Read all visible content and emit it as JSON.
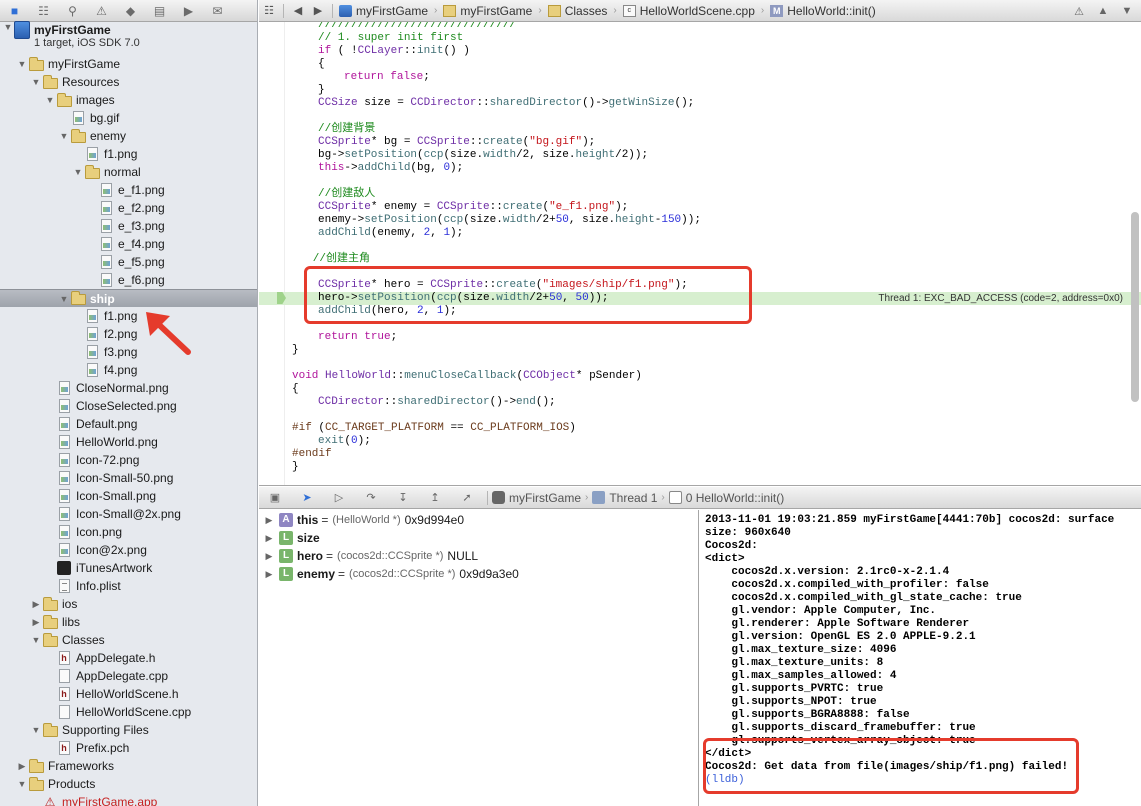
{
  "navigator": {
    "toolbar": [
      "folder-icon",
      "symbol-icon",
      "search-icon",
      "warning-icon",
      "test-icon",
      "debug-icon",
      "breakpoint-icon",
      "log-icon"
    ],
    "project": {
      "name": "myFirstGame",
      "subtitle": "1 target, iOS SDK 7.0"
    },
    "tree": [
      {
        "label": "myFirstGame",
        "kind": "folder",
        "depth": 1,
        "open": true
      },
      {
        "label": "Resources",
        "kind": "folder",
        "depth": 2,
        "open": true
      },
      {
        "label": "images",
        "kind": "folder",
        "depth": 3,
        "open": true
      },
      {
        "label": "bg.gif",
        "kind": "image",
        "depth": 4
      },
      {
        "label": "enemy",
        "kind": "folder",
        "depth": 4,
        "open": true
      },
      {
        "label": "f1.png",
        "kind": "image",
        "depth": 5
      },
      {
        "label": "normal",
        "kind": "folder",
        "depth": 5,
        "open": true
      },
      {
        "label": "e_f1.png",
        "kind": "image",
        "depth": 6
      },
      {
        "label": "e_f2.png",
        "kind": "image",
        "depth": 6
      },
      {
        "label": "e_f3.png",
        "kind": "image",
        "depth": 6
      },
      {
        "label": "e_f4.png",
        "kind": "image",
        "depth": 6
      },
      {
        "label": "e_f5.png",
        "kind": "image",
        "depth": 6
      },
      {
        "label": "e_f6.png",
        "kind": "image",
        "depth": 6
      },
      {
        "label": "ship",
        "kind": "folder",
        "depth": 4,
        "open": true,
        "selected": true
      },
      {
        "label": "f1.png",
        "kind": "image",
        "depth": 5
      },
      {
        "label": "f2.png",
        "kind": "image",
        "depth": 5
      },
      {
        "label": "f3.png",
        "kind": "image",
        "depth": 5
      },
      {
        "label": "f4.png",
        "kind": "image",
        "depth": 5
      },
      {
        "label": "CloseNormal.png",
        "kind": "image",
        "depth": 3
      },
      {
        "label": "CloseSelected.png",
        "kind": "image",
        "depth": 3
      },
      {
        "label": "Default.png",
        "kind": "image",
        "depth": 3
      },
      {
        "label": "HelloWorld.png",
        "kind": "image",
        "depth": 3
      },
      {
        "label": "Icon-72.png",
        "kind": "image",
        "depth": 3
      },
      {
        "label": "Icon-Small-50.png",
        "kind": "image",
        "depth": 3
      },
      {
        "label": "Icon-Small.png",
        "kind": "image",
        "depth": 3
      },
      {
        "label": "Icon-Small@2x.png",
        "kind": "image",
        "depth": 3
      },
      {
        "label": "Icon.png",
        "kind": "image",
        "depth": 3
      },
      {
        "label": "Icon@2x.png",
        "kind": "image",
        "depth": 3
      },
      {
        "label": "iTunesArtwork",
        "kind": "itunes",
        "depth": 3
      },
      {
        "label": "Info.plist",
        "kind": "plist",
        "depth": 3
      },
      {
        "label": "ios",
        "kind": "folder",
        "depth": 2,
        "open": false
      },
      {
        "label": "libs",
        "kind": "folder",
        "depth": 2,
        "open": false
      },
      {
        "label": "Classes",
        "kind": "folder",
        "depth": 2,
        "open": true
      },
      {
        "label": "AppDelegate.h",
        "kind": "header",
        "depth": 3
      },
      {
        "label": "AppDelegate.cpp",
        "kind": "source",
        "depth": 3
      },
      {
        "label": "HelloWorldScene.h",
        "kind": "header",
        "depth": 3
      },
      {
        "label": "HelloWorldScene.cpp",
        "kind": "source",
        "depth": 3
      },
      {
        "label": "Supporting Files",
        "kind": "folder",
        "depth": 2,
        "open": true
      },
      {
        "label": "Prefix.pch",
        "kind": "header",
        "depth": 3
      },
      {
        "label": "Frameworks",
        "kind": "folder",
        "depth": 1,
        "open": false
      },
      {
        "label": "Products",
        "kind": "folder",
        "depth": 1,
        "open": true
      },
      {
        "label": "myFirstGame.app",
        "kind": "app",
        "depth": 2,
        "red": true
      }
    ]
  },
  "jumpbar": {
    "crumbs": [
      {
        "label": "myFirstGame",
        "icon": "project-icon"
      },
      {
        "label": "myFirstGame",
        "icon": "folder-icon"
      },
      {
        "label": "Classes",
        "icon": "folder-icon"
      },
      {
        "label": "HelloWorldScene.cpp",
        "icon": "cpp-file-icon"
      },
      {
        "label": "HelloWorld::init()",
        "icon": "method-icon"
      }
    ]
  },
  "editor": {
    "thread_message": "Thread 1: EXC_BAD_ACCESS (code=2, address=0x0)",
    "lines": [
      {
        "s": [
          [
            "c",
            "//////////////////////////////"
          ]
        ],
        "i": 1
      },
      {
        "s": [
          [
            "c",
            "// 1. super init first"
          ]
        ],
        "i": 1
      },
      {
        "s": [
          [
            "k",
            "if"
          ],
          [
            "t",
            " ( !"
          ],
          [
            "y",
            "CCLayer"
          ],
          [
            "t",
            "::"
          ],
          [
            "f",
            "init"
          ],
          [
            "t",
            "() )"
          ]
        ],
        "i": 1
      },
      {
        "s": [
          [
            "t",
            "{"
          ]
        ],
        "i": 1
      },
      {
        "s": [
          [
            "k",
            "return"
          ],
          [
            "t",
            " "
          ],
          [
            "k",
            "false"
          ],
          [
            "t",
            ";"
          ]
        ],
        "i": 2
      },
      {
        "s": [
          [
            "t",
            "}"
          ]
        ],
        "i": 1
      },
      {
        "s": [
          [
            "y",
            "CCSize"
          ],
          [
            "t",
            " size = "
          ],
          [
            "y",
            "CCDirector"
          ],
          [
            "t",
            "::"
          ],
          [
            "f",
            "sharedDirector"
          ],
          [
            "t",
            "()->"
          ],
          [
            "f",
            "getWinSize"
          ],
          [
            "t",
            "();"
          ]
        ],
        "i": 1
      },
      {
        "s": [],
        "i": 0
      },
      {
        "s": [
          [
            "c",
            "//创建背景"
          ]
        ],
        "i": 1
      },
      {
        "s": [
          [
            "y",
            "CCSprite"
          ],
          [
            "t",
            "* bg = "
          ],
          [
            "y",
            "CCSprite"
          ],
          [
            "t",
            "::"
          ],
          [
            "f",
            "create"
          ],
          [
            "t",
            "("
          ],
          [
            "s",
            "\"bg.gif\""
          ],
          [
            "t",
            ");"
          ]
        ],
        "i": 1
      },
      {
        "s": [
          [
            "t",
            "bg->"
          ],
          [
            "f",
            "setPosition"
          ],
          [
            "t",
            "("
          ],
          [
            "f",
            "ccp"
          ],
          [
            "t",
            "(size."
          ],
          [
            "f",
            "width"
          ],
          [
            "t",
            "/2, size."
          ],
          [
            "f",
            "height"
          ],
          [
            "t",
            "/2));"
          ]
        ],
        "i": 1
      },
      {
        "s": [
          [
            "k",
            "this"
          ],
          [
            "t",
            "->"
          ],
          [
            "f",
            "addChild"
          ],
          [
            "t",
            "(bg, "
          ],
          [
            "n",
            "0"
          ],
          [
            "t",
            ");"
          ]
        ],
        "i": 1
      },
      {
        "s": [],
        "i": 0
      },
      {
        "s": [
          [
            "c",
            "//创建敌人"
          ]
        ],
        "i": 1
      },
      {
        "s": [
          [
            "y",
            "CCSprite"
          ],
          [
            "t",
            "* enemy = "
          ],
          [
            "y",
            "CCSprite"
          ],
          [
            "t",
            "::"
          ],
          [
            "f",
            "create"
          ],
          [
            "t",
            "("
          ],
          [
            "s",
            "\"e_f1.png\""
          ],
          [
            "t",
            ");"
          ]
        ],
        "i": 1
      },
      {
        "s": [
          [
            "t",
            "enemy->"
          ],
          [
            "f",
            "setPosition"
          ],
          [
            "t",
            "("
          ],
          [
            "f",
            "ccp"
          ],
          [
            "t",
            "(size."
          ],
          [
            "f",
            "width"
          ],
          [
            "t",
            "/2+"
          ],
          [
            "n",
            "50"
          ],
          [
            "t",
            ", size."
          ],
          [
            "f",
            "height"
          ],
          [
            "t",
            "-"
          ],
          [
            "n",
            "150"
          ],
          [
            "t",
            "));"
          ]
        ],
        "i": 1
      },
      {
        "s": [
          [
            "f",
            "addChild"
          ],
          [
            "t",
            "(enemy, "
          ],
          [
            "n",
            "2"
          ],
          [
            "t",
            ", "
          ],
          [
            "n",
            "1"
          ],
          [
            "t",
            ");"
          ]
        ],
        "i": 1
      },
      {
        "s": [],
        "i": 0
      },
      {
        "s": [
          [
            "c",
            "//创建主角"
          ]
        ],
        "i": 0.8
      },
      {
        "s": [],
        "i": 0
      },
      {
        "s": [
          [
            "y",
            "CCSprite"
          ],
          [
            "t",
            "* hero = "
          ],
          [
            "y",
            "CCSprite"
          ],
          [
            "t",
            "::"
          ],
          [
            "f",
            "create"
          ],
          [
            "t",
            "("
          ],
          [
            "s",
            "\"images/ship/f1.png\""
          ],
          [
            "t",
            ");"
          ]
        ],
        "i": 1
      },
      {
        "s": [
          [
            "t",
            "hero->"
          ],
          [
            "f",
            "setPosition"
          ],
          [
            "t",
            "("
          ],
          [
            "f",
            "ccp"
          ],
          [
            "t",
            "(size."
          ],
          [
            "f",
            "width"
          ],
          [
            "t",
            "/2+"
          ],
          [
            "n",
            "50"
          ],
          [
            "t",
            ", "
          ],
          [
            "n",
            "50"
          ],
          [
            "t",
            "));"
          ]
        ],
        "i": 1,
        "hl": true
      },
      {
        "s": [
          [
            "f",
            "addChild"
          ],
          [
            "t",
            "(hero, "
          ],
          [
            "n",
            "2"
          ],
          [
            "t",
            ", "
          ],
          [
            "n",
            "1"
          ],
          [
            "t",
            ");"
          ]
        ],
        "i": 1
      },
      {
        "s": [],
        "i": 0
      },
      {
        "s": [
          [
            "k",
            "return"
          ],
          [
            "t",
            " "
          ],
          [
            "k",
            "true"
          ],
          [
            "t",
            ";"
          ]
        ],
        "i": 1
      },
      {
        "s": [
          [
            "t",
            "}"
          ]
        ],
        "i": 0
      },
      {
        "s": [],
        "i": 0
      },
      {
        "s": [
          [
            "k",
            "void"
          ],
          [
            "t",
            " "
          ],
          [
            "y",
            "HelloWorld"
          ],
          [
            "t",
            "::"
          ],
          [
            "f",
            "menuCloseCallback"
          ],
          [
            "t",
            "("
          ],
          [
            "y",
            "CCObject"
          ],
          [
            "t",
            "* pSender)"
          ]
        ],
        "i": 0
      },
      {
        "s": [
          [
            "t",
            "{"
          ]
        ],
        "i": 0
      },
      {
        "s": [
          [
            "y",
            "CCDirector"
          ],
          [
            "t",
            "::"
          ],
          [
            "f",
            "sharedDirector"
          ],
          [
            "t",
            "()->"
          ],
          [
            "f",
            "end"
          ],
          [
            "t",
            "();"
          ]
        ],
        "i": 1
      },
      {
        "s": [],
        "i": 0
      },
      {
        "s": [
          [
            "m",
            "#if"
          ],
          [
            "t",
            " ("
          ],
          [
            "m",
            "CC_TARGET_PLATFORM"
          ],
          [
            "t",
            " == "
          ],
          [
            "m",
            "CC_PLATFORM_IOS"
          ],
          [
            "t",
            ")"
          ]
        ],
        "i": 0
      },
      {
        "s": [
          [
            "f",
            "exit"
          ],
          [
            "t",
            "("
          ],
          [
            "n",
            "0"
          ],
          [
            "t",
            ");"
          ]
        ],
        "i": 1
      },
      {
        "s": [
          [
            "m",
            "#endif"
          ]
        ],
        "i": 0
      },
      {
        "s": [
          [
            "t",
            "}"
          ]
        ],
        "i": 0
      }
    ]
  },
  "debugbar": {
    "crumbs": [
      {
        "label": "myFirstGame",
        "icon": "app-icon"
      },
      {
        "label": "Thread 1",
        "icon": "thread-icon"
      },
      {
        "label": "0 HelloWorld::init()",
        "icon": "frame-icon"
      }
    ]
  },
  "variables": [
    {
      "badge": "A",
      "name": "this",
      "type": "(HelloWorld *)",
      "value": "0x9d994e0"
    },
    {
      "badge": "L",
      "name": "size",
      "type": "",
      "value": ""
    },
    {
      "badge": "L",
      "name": "hero",
      "type": "(cocos2d::CCSprite *)",
      "value": "NULL"
    },
    {
      "badge": "L",
      "name": "enemy",
      "type": "(cocos2d::CCSprite *)",
      "value": "0x9d9a3e0"
    }
  ],
  "console": [
    "2013-11-01 19:03:21.859 myFirstGame[4441:70b] cocos2d: surface",
    "size: 960x640",
    "Cocos2d:",
    "<dict>",
    "    cocos2d.x.version: 2.1rc0-x-2.1.4",
    "    cocos2d.x.compiled_with_profiler: false",
    "    cocos2d.x.compiled_with_gl_state_cache: true",
    "    gl.vendor: Apple Computer, Inc.",
    "    gl.renderer: Apple Software Renderer",
    "    gl.version: OpenGL ES 2.0 APPLE-9.2.1",
    "    gl.max_texture_size: 4096",
    "    gl.max_texture_units: 8",
    "    gl.max_samples_allowed: 4",
    "    gl.supports_PVRTC: true",
    "    gl.supports_NPOT: true",
    "    gl.supports_BGRA8888: false",
    "    gl.supports_discard_framebuffer: true",
    "    gl.supports_vertex_array_object: true",
    "</dict>",
    "Cocos2d: Get data from file(images/ship/f1.png) failed!",
    "(lldb)"
  ],
  "colors": {
    "annotation": "#e53b2c",
    "selection": "#9ea3ab",
    "highlight_line": "#d7efcf"
  }
}
